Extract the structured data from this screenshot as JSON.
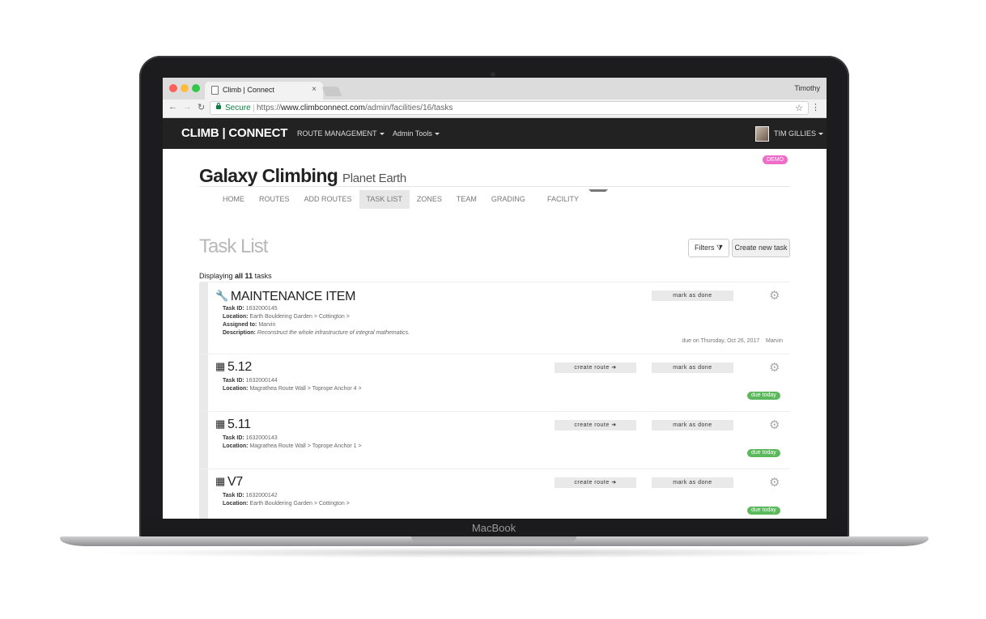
{
  "device": {
    "label": "MacBook"
  },
  "browser": {
    "tab_title": "Climb | Connect",
    "tab_close": "×",
    "profile": "Timothy",
    "secure_label": "Secure",
    "url_scheme": "https://",
    "url_host": "www.climbconnect.com",
    "url_path": "/admin/facilities/16/tasks",
    "back": "←",
    "forward": "→",
    "reload": "↻",
    "star": "☆",
    "menu": "⋮"
  },
  "appbar": {
    "brand": "CLIMB | CONNECT",
    "menu_route_management": "ROUTE MANAGEMENT",
    "menu_admin_tools": "Admin Tools",
    "user_name": "TIM GILLIES"
  },
  "page": {
    "demo_badge": "DEMO",
    "facility_name": "Galaxy Climbing",
    "facility_location": "Planet Earth",
    "subnav": [
      "HOME",
      "ROUTES",
      "ADD ROUTES",
      "TASK LIST",
      "ZONES",
      "TEAM",
      "GRADING",
      "FACILITY"
    ],
    "subnav_active": "TASK LIST",
    "heading": "Task List",
    "filters_label": "Filters",
    "filter_icon": "⧩",
    "create_label": "Create new task",
    "displaying_prefix": "Displaying",
    "displaying_count": "all 11",
    "displaying_suffix": "tasks"
  },
  "tasks": [
    {
      "icon": "wrench-icon",
      "title": "MAINTENANCE ITEM",
      "task_id_label": "Task ID:",
      "task_id": "1632000145",
      "location_label": "Location:",
      "location": "Earth Bouldering Garden > Cottington >",
      "assigned_label": "Assigned to:",
      "assigned": "Marvin",
      "description_label": "Description:",
      "description": "Reconstruct the whole infrastructure of integral mathematics.",
      "mark_done": "mark as done",
      "due_text": "due on Thursday, Oct 26, 2017",
      "due_who": "Marvin"
    },
    {
      "icon": "calendar-icon",
      "title": "5.12",
      "task_id_label": "Task ID:",
      "task_id": "1632000144",
      "location_label": "Location:",
      "location": "Magrathea Route Wall > Toprope Anchor 4 >",
      "create_route": "create route ➜",
      "mark_done": "mark as done",
      "due_badge": "due today"
    },
    {
      "icon": "calendar-icon",
      "title": "5.11",
      "task_id_label": "Task ID:",
      "task_id": "1632000143",
      "location_label": "Location:",
      "location": "Magrathea Route Wall > Toprope Anchor 1 >",
      "create_route": "create route ➜",
      "mark_done": "mark as done",
      "due_badge": "due today"
    },
    {
      "icon": "calendar-icon",
      "title": "V7",
      "task_id_label": "Task ID:",
      "task_id": "1632000142",
      "location_label": "Location:",
      "location": "Earth Bouldering Garden > Cottington >",
      "create_route": "create route ➜",
      "mark_done": "mark as done",
      "due_badge": "due today"
    }
  ],
  "icons": {
    "gear": "⚙",
    "wrench": "🔧",
    "calendar": "▦"
  }
}
